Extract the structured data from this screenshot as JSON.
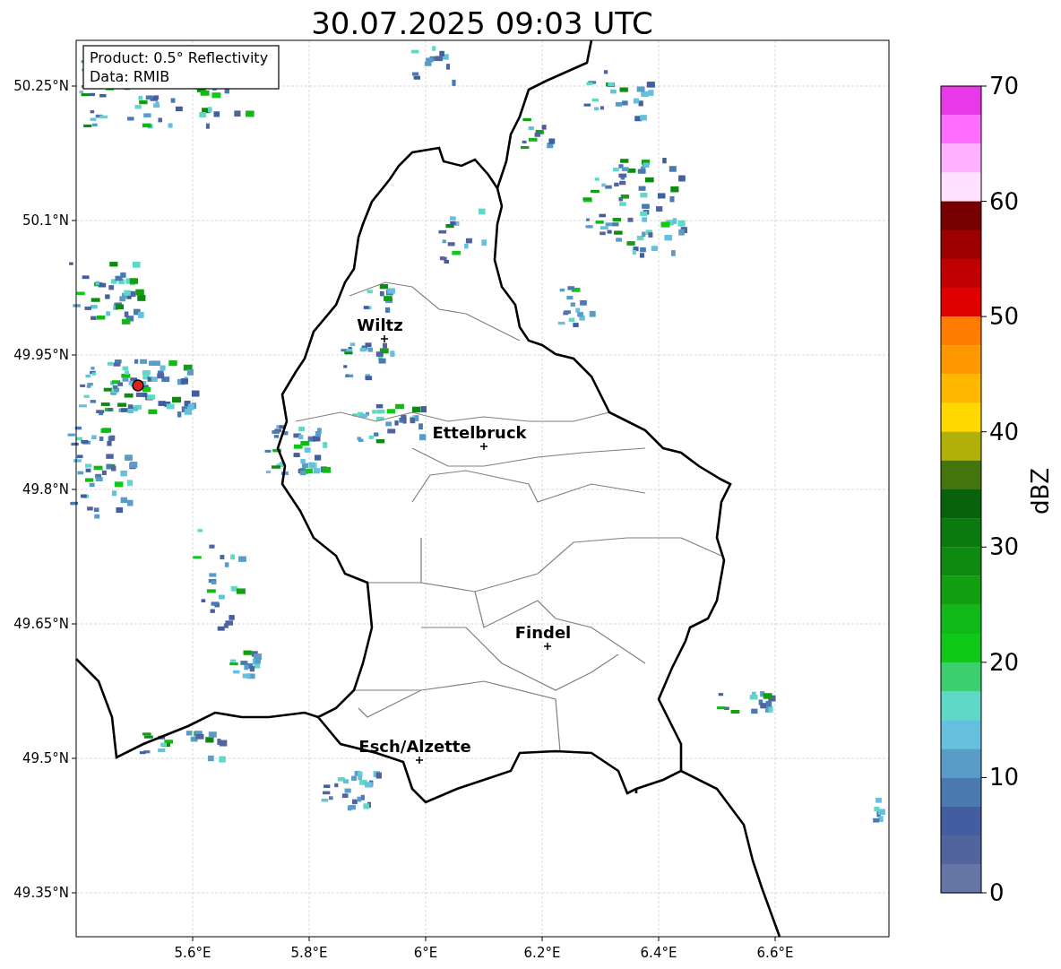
{
  "title": "30.07.2025 09:03 UTC",
  "info_box": [
    "Product: 0.5° Reflectivity",
    "Data: RMIB"
  ],
  "map": {
    "x_ticks": [
      "5.6°E",
      "5.8°E",
      "6°E",
      "6.2°E",
      "6.4°E",
      "6.6°E"
    ],
    "y_ticks": [
      "50.25°N",
      "50.1°N",
      "49.95°N",
      "49.8°N",
      "49.65°N",
      "49.5°N",
      "49.35°N"
    ],
    "cities": [
      "Wiltz",
      "Ettelbruck",
      "Findel",
      "Esch/Alzette"
    ]
  },
  "colorbar": {
    "label": "dBZ",
    "ticks": [
      "70",
      "60",
      "50",
      "40",
      "30",
      "20",
      "10",
      "0"
    ],
    "bands": [
      {
        "color": "#e838e8"
      },
      {
        "color": "#ff6cff"
      },
      {
        "color": "#ffb0ff"
      },
      {
        "color": "#ffe0ff"
      },
      {
        "color": "#780000"
      },
      {
        "color": "#9c0000"
      },
      {
        "color": "#c00000"
      },
      {
        "color": "#e00000"
      },
      {
        "color": "#ff7c00"
      },
      {
        "color": "#ff9800"
      },
      {
        "color": "#ffb800"
      },
      {
        "color": "#ffd800"
      },
      {
        "color": "#b0b008"
      },
      {
        "color": "#44740c"
      },
      {
        "color": "#08620c"
      },
      {
        "color": "#0a7a0e"
      },
      {
        "color": "#0e8a10"
      },
      {
        "color": "#10a010"
      },
      {
        "color": "#10b818"
      },
      {
        "color": "#10c818"
      },
      {
        "color": "#3cd070"
      },
      {
        "color": "#60d8c8"
      },
      {
        "color": "#64c0dc"
      },
      {
        "color": "#5a9cc8"
      },
      {
        "color": "#4a7ab0"
      },
      {
        "color": "#425ea0"
      },
      {
        "color": "#52649e"
      },
      {
        "color": "#6676a6"
      }
    ]
  }
}
